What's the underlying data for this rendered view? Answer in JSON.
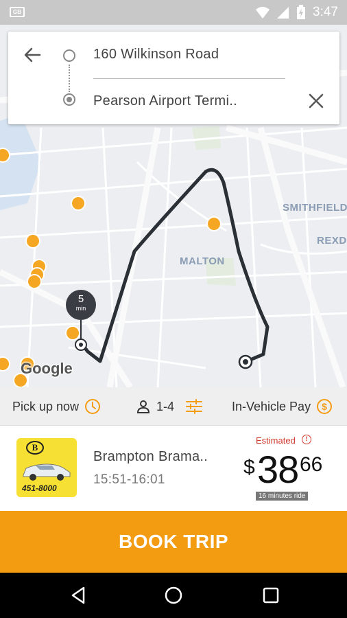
{
  "status_bar": {
    "notification_icon": "GB",
    "time": "3:47",
    "icons": [
      "wifi-icon",
      "signal-icon",
      "battery-charging-icon"
    ]
  },
  "address": {
    "origin": "160 Wilkinson Road",
    "destination": "Pearson Airport Termi..",
    "icons": [
      "back-arrow-icon",
      "origin-dot-icon",
      "destination-dot-icon",
      "close-icon"
    ]
  },
  "map": {
    "labels": [
      "SMITHFIELD",
      "REXDA",
      "MALTON"
    ],
    "eta_value": "5",
    "eta_unit": "min",
    "attribution": "Google",
    "route_color": "#2b2f36",
    "marker_color": "#f5a623"
  },
  "options": {
    "pickup_label": "Pick up now",
    "passengers_label": "1-4",
    "payment_label": "In-Vehicle Pay",
    "accent": "#f39c12",
    "icons": [
      "clock-icon",
      "person-icon",
      "filter-sliders-icon",
      "dollar-circle-icon"
    ]
  },
  "trip": {
    "logo_badge": "B",
    "logo_phone": "451-8000",
    "company": "Brampton Brama..",
    "time_window": "15:51-16:01",
    "estimated_label": "Estimated",
    "price_currency": "$",
    "price_dollars": "38",
    "price_cents": "66",
    "ride_length": "16 minutes ride",
    "estimated_color": "#d23b2f"
  },
  "book_button": {
    "label": "BOOK TRIP",
    "color": "#f39c12"
  },
  "nav_bar": {
    "icons": [
      "back-triangle-icon",
      "home-circle-icon",
      "recents-square-icon"
    ]
  }
}
